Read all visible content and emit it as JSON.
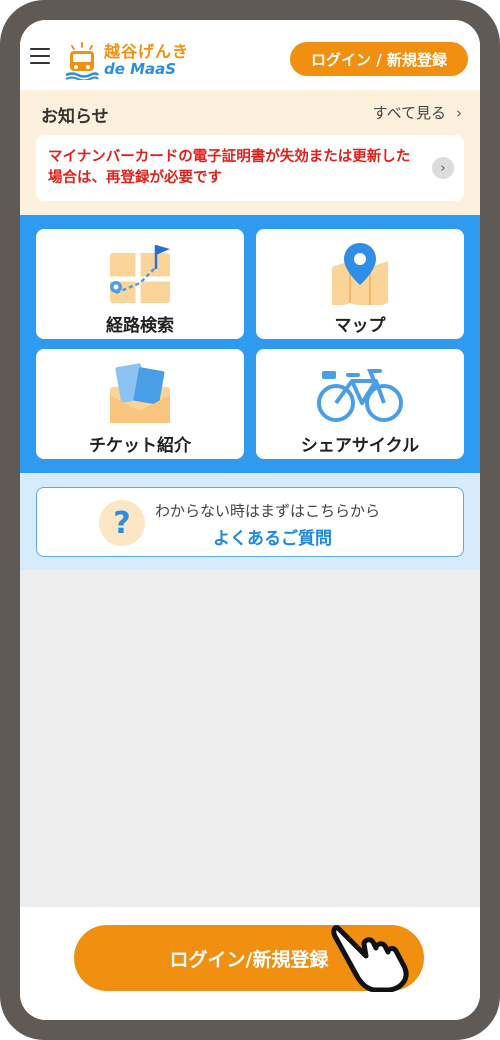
{
  "header": {
    "logo_line1": "越谷げんき",
    "logo_line2": "de MaaS",
    "login_button": "ログイン / 新規登録"
  },
  "notice": {
    "title": "お知らせ",
    "see_all": "すべて見る",
    "message": "マイナンバーカードの電子証明書が失効または更新した場合は、再登録が必要です"
  },
  "menu": {
    "route_search": "経路検索",
    "map": "マップ",
    "ticket": "チケット紹介",
    "bike": "シェアサイクル"
  },
  "faq": {
    "subtitle": "わからない時はまずはこちらから",
    "link": "よくあるご質問"
  },
  "bottom": {
    "login_button": "ログイン/新規登録"
  },
  "colors": {
    "accent_orange": "#f08f10",
    "accent_blue": "#2f9bf0",
    "notice_red": "#e0221c"
  }
}
